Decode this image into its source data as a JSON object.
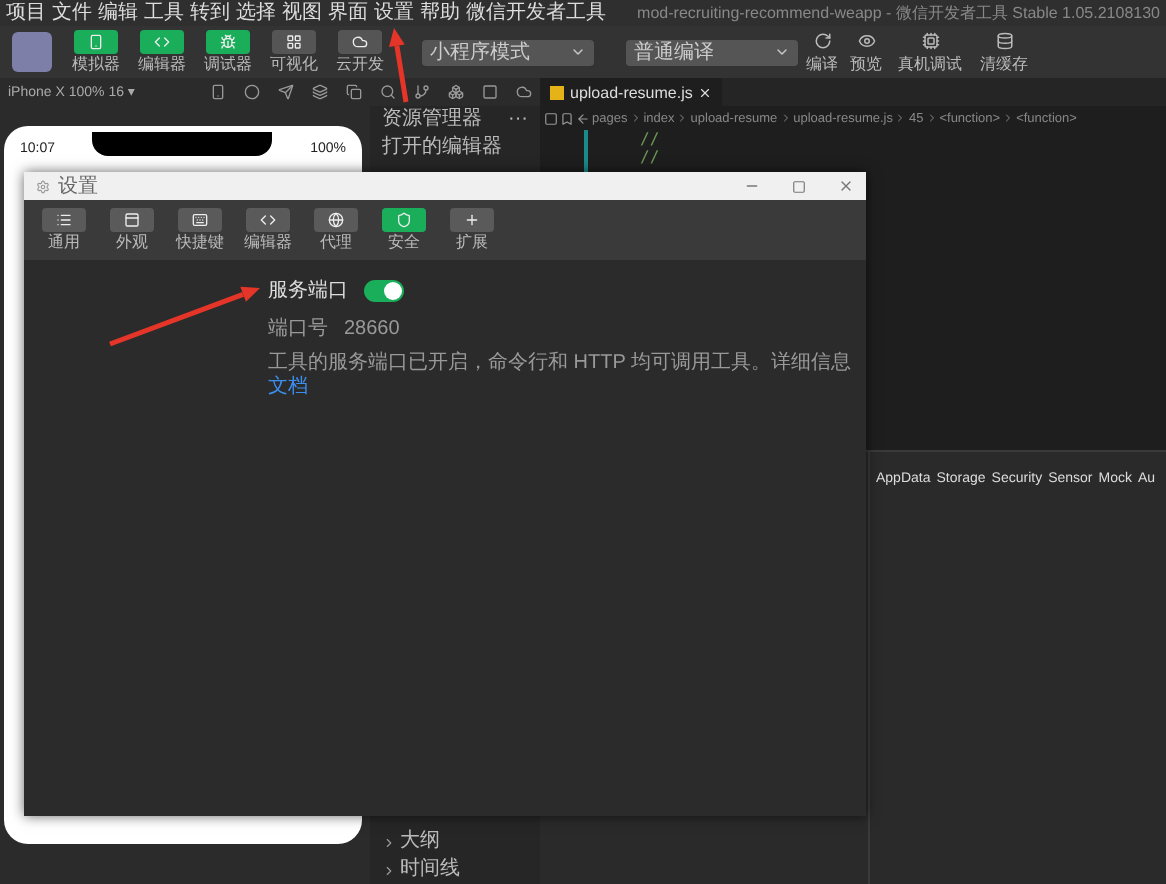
{
  "menu": [
    "项目",
    "文件",
    "编辑",
    "工具",
    "转到",
    "选择",
    "视图",
    "界面",
    "设置",
    "帮助",
    "微信开发者工具"
  ],
  "window_title": "mod-recruiting-recommend-weapp - 微信开发者工具 Stable 1.05.2108130",
  "toolbar": {
    "buttons": [
      {
        "label": "模拟器",
        "active": true
      },
      {
        "label": "编辑器",
        "active": true
      },
      {
        "label": "调试器",
        "active": true
      },
      {
        "label": "可视化",
        "active": false
      },
      {
        "label": "云开发",
        "active": false
      }
    ],
    "mode_select": "小程序模式",
    "compile_select": "普通编译",
    "actions": [
      "编译",
      "预览",
      "真机调试",
      "清缓存"
    ]
  },
  "simulator": {
    "device": "iPhone X 100% 16 ▾",
    "time": "10:07",
    "battery": "100%"
  },
  "explorer": {
    "title": "资源管理器",
    "more": "···",
    "sections": [
      "打开的编辑器"
    ],
    "bottom": [
      "大纲",
      "时间线"
    ]
  },
  "editor": {
    "tab": "upload-resume.js",
    "breadcrumb": [
      "pages",
      "index",
      "upload-resume",
      "upload-resume.js",
      "45",
      "<function>",
      "<function>"
    ],
    "lines": [
      "//",
      "//"
    ]
  },
  "debugger": {
    "tabs": [
      "AppData",
      "Storage",
      "Security",
      "Sensor",
      "Mock",
      "Au"
    ]
  },
  "settings": {
    "title": "设置",
    "tabs": [
      {
        "label": "通用",
        "kind": "list",
        "selected": false
      },
      {
        "label": "外观",
        "kind": "layout",
        "selected": false
      },
      {
        "label": "快捷键",
        "kind": "keys",
        "selected": false
      },
      {
        "label": "编辑器",
        "kind": "code",
        "selected": false
      },
      {
        "label": "代理",
        "kind": "globe",
        "selected": false
      },
      {
        "label": "安全",
        "kind": "shield",
        "selected": true
      },
      {
        "label": "扩展",
        "kind": "plus",
        "selected": false
      }
    ],
    "service_port": {
      "label": "服务端口",
      "on": true
    },
    "port": {
      "label": "端口号",
      "value": "28660"
    },
    "description": "工具的服务端口已开启，命令行和 HTTP 均可调用工具。详细信息",
    "link": "文档"
  }
}
